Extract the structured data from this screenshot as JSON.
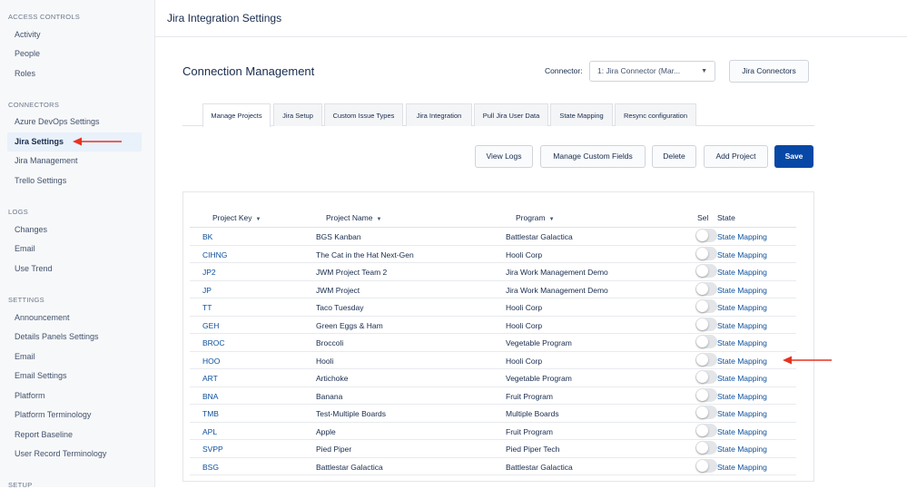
{
  "page_title": "Jira Integration Settings",
  "sidebar": {
    "sections": [
      {
        "heading": "ACCESS CONTROLS",
        "items": [
          "Activity",
          "People",
          "Roles"
        ]
      },
      {
        "heading": "CONNECTORS",
        "items": [
          "Azure DevOps Settings",
          "Jira Settings",
          "Jira Management",
          "Trello Settings"
        ]
      },
      {
        "heading": "LOGS",
        "items": [
          "Changes",
          "Email",
          "Use Trend"
        ]
      },
      {
        "heading": "SETTINGS",
        "items": [
          "Announcement",
          "Details Panels Settings",
          "Email",
          "Email Settings",
          "Platform",
          "Platform Terminology",
          "Report Baseline",
          "User Record Terminology"
        ]
      },
      {
        "heading": "SETUP",
        "items": []
      }
    ],
    "active_item": "Jira Settings"
  },
  "main": {
    "title": "Connection Management",
    "connector_label": "Connector:",
    "connector_value": "1: Jira Connector (Mar...",
    "jira_connectors_button": "Jira Connectors",
    "tabs": [
      "Manage Projects",
      "Jira Setup",
      "Custom Issue Types",
      "Jira Integration",
      "Pull Jira User Data",
      "State Mapping",
      "Resync configuration"
    ],
    "active_tab": "Manage Projects",
    "actions": {
      "view_logs": "View Logs",
      "manage_custom_fields": "Manage Custom Fields",
      "delete": "Delete",
      "add_project": "Add Project",
      "save": "Save"
    },
    "table": {
      "headers": {
        "key": "Project Key",
        "name": "Project Name",
        "program": "Program",
        "sel": "Sel",
        "state": "State"
      },
      "rows": [
        {
          "key": "BK",
          "name": "BGS Kanban",
          "program": "Battlestar Galactica",
          "state": "State Mapping",
          "selected": false
        },
        {
          "key": "CIHNG",
          "name": "The Cat in the Hat Next-Gen",
          "program": "Hooli Corp",
          "state": "State Mapping",
          "selected": false
        },
        {
          "key": "JP2",
          "name": "JWM Project Team 2",
          "program": "Jira Work Management Demo",
          "state": "State Mapping",
          "selected": false
        },
        {
          "key": "JP",
          "name": "JWM Project",
          "program": "Jira Work Management Demo",
          "state": "State Mapping",
          "selected": false
        },
        {
          "key": "TT",
          "name": "Taco Tuesday",
          "program": "Hooli Corp",
          "state": "State Mapping",
          "selected": false
        },
        {
          "key": "GEH",
          "name": "Green Eggs & Ham",
          "program": "Hooli Corp",
          "state": "State Mapping",
          "selected": false
        },
        {
          "key": "BROC",
          "name": "Broccoli",
          "program": "Vegetable Program",
          "state": "State Mapping",
          "selected": false
        },
        {
          "key": "HOO",
          "name": "Hooli",
          "program": "Hooli Corp",
          "state": "State Mapping",
          "selected": false
        },
        {
          "key": "ART",
          "name": "Artichoke",
          "program": "Vegetable Program",
          "state": "State Mapping",
          "selected": false
        },
        {
          "key": "BNA",
          "name": "Banana",
          "program": "Fruit Program",
          "state": "State Mapping",
          "selected": false
        },
        {
          "key": "TMB",
          "name": "Test-Multiple Boards",
          "program": "Multiple Boards",
          "state": "State Mapping",
          "selected": false
        },
        {
          "key": "APL",
          "name": "Apple",
          "program": "Fruit Program",
          "state": "State Mapping",
          "selected": false
        },
        {
          "key": "SVPP",
          "name": "Pied Piper",
          "program": "Pied Piper Tech",
          "state": "State Mapping",
          "selected": false
        },
        {
          "key": "BSG",
          "name": "Battlestar Galactica",
          "program": "Battlestar Galactica",
          "state": "State Mapping",
          "selected": false
        }
      ]
    }
  },
  "colors": {
    "accent": "#0747a6",
    "link": "#0b4f9c",
    "annotation_arrow": "#e8321f",
    "active_nav_bg": "#e9f1fb"
  }
}
